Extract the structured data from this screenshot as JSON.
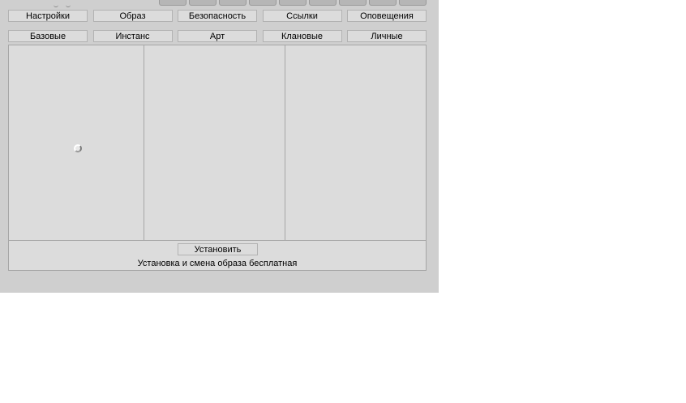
{
  "top_tabs": [
    "Настройки",
    "Образ",
    "Безопасность",
    "Ссылки",
    "Оповещения"
  ],
  "sub_tabs": [
    "Базовые",
    "Инстанс",
    "Арт",
    "Клановые",
    "Личные"
  ],
  "install_button_label": "Установить",
  "footer_note": "Установка и смена образа бесплатная",
  "loading_indicator": "spinner-icon"
}
